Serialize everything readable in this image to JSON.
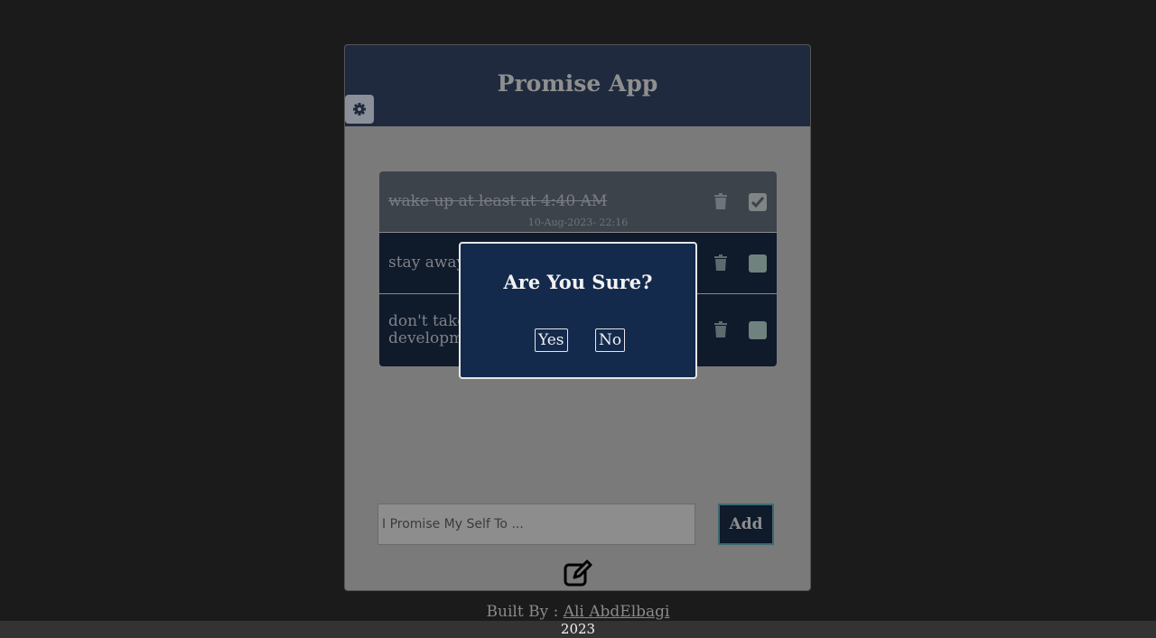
{
  "app": {
    "title": "Promise App",
    "promises": [
      {
        "text": "wake up at least at 4:40 AM",
        "date": "10-Aug-2023- 22:16",
        "done": true
      },
      {
        "text": "stay away",
        "done": false
      },
      {
        "text_line1": "don't take",
        "text_line2": "developm",
        "done": false
      }
    ],
    "input": {
      "placeholder": "I Promise My Self To ..."
    },
    "add_label": "Add"
  },
  "modal": {
    "title": "Are You Sure?",
    "yes_label": "Yes",
    "no_label": "No"
  },
  "footer": {
    "built_by": "Built By : ",
    "author": "Ali AbdElbagi",
    "year": "2023"
  },
  "icons": [
    "gear-icon",
    "trash-icon",
    "checkbox-icon",
    "edit-icon"
  ],
  "colors": {
    "header": "#1f2a3e",
    "modal_bg": "#142a4c",
    "background": "#1b1b1b"
  }
}
